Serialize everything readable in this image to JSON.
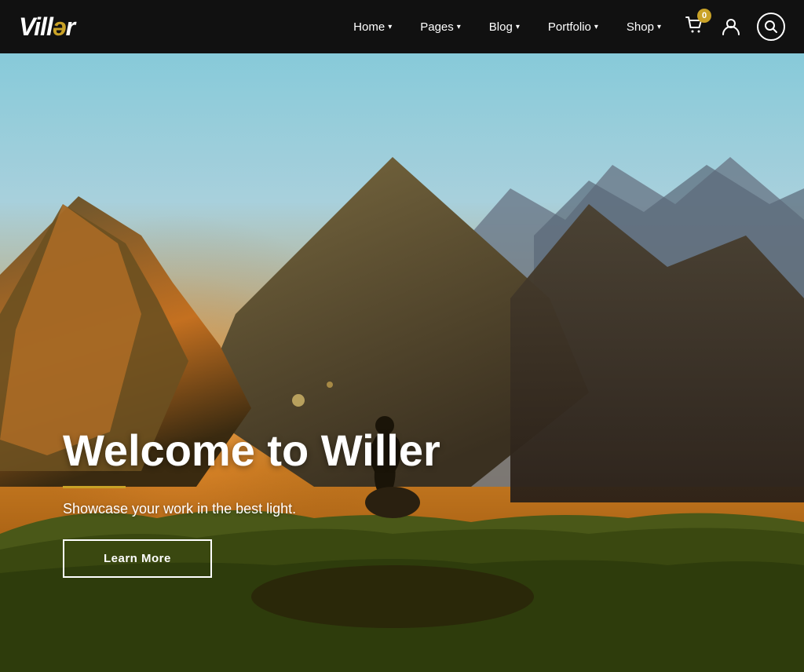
{
  "brand": {
    "name_start": "Vill",
    "name_highlight": "ə",
    "name_end": "r"
  },
  "navbar": {
    "links": [
      {
        "label": "Home",
        "hasDropdown": true
      },
      {
        "label": "Pages",
        "hasDropdown": true
      },
      {
        "label": "Blog",
        "hasDropdown": true
      },
      {
        "label": "Portfolio",
        "hasDropdown": true
      },
      {
        "label": "Shop",
        "hasDropdown": true
      }
    ],
    "cart_count": "0",
    "icons": {
      "cart": "🛒",
      "user": "👤",
      "search": "🔍"
    }
  },
  "hero": {
    "title": "Welcome to Willer",
    "subtitle": "Showcase your work in the best light.",
    "cta_label": "Learn More",
    "accent_color": "#c9a227"
  }
}
